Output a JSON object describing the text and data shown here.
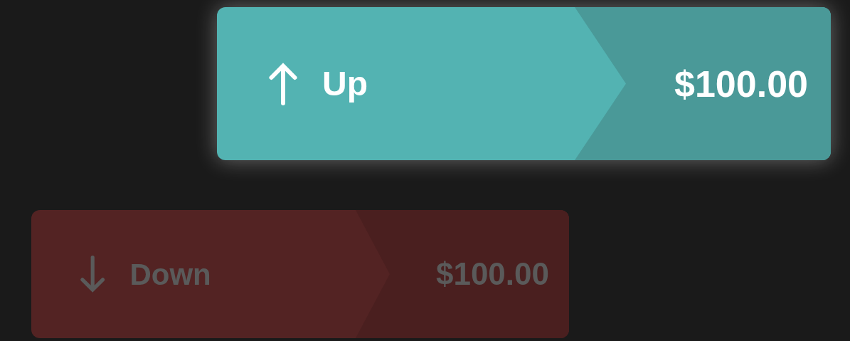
{
  "buttons": [
    {
      "kind": "up",
      "label": "Up",
      "amount": "$100.00",
      "selected": true
    },
    {
      "kind": "down",
      "label": "Down",
      "amount": "$100.00",
      "selected": false
    }
  ]
}
